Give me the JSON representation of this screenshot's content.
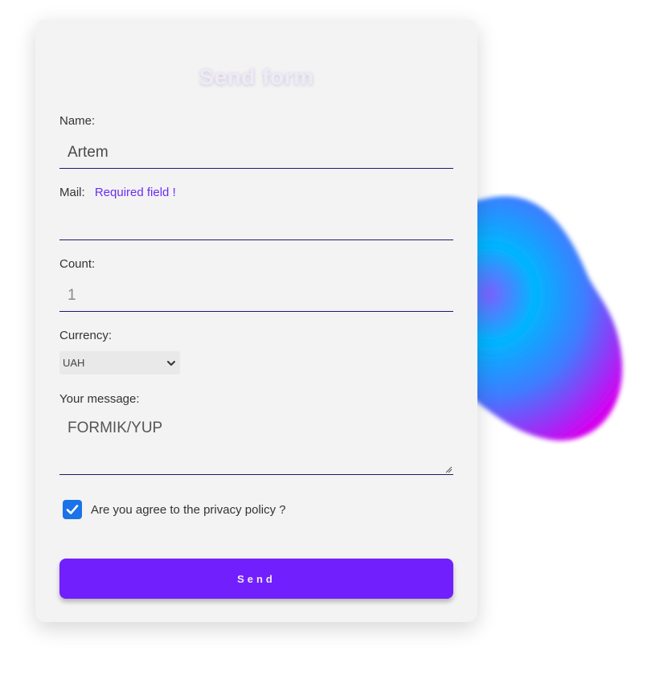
{
  "form": {
    "title": "Send form",
    "name": {
      "label": "Name:",
      "value": "Artem"
    },
    "mail": {
      "label": "Mail:",
      "error": "Required field !",
      "value": ""
    },
    "count": {
      "label": "Count:",
      "value": "1"
    },
    "currency": {
      "label": "Currency:",
      "selected": "UAH"
    },
    "message": {
      "label": "Your message:",
      "value": "FORMIK/YUP"
    },
    "privacy": {
      "label": "Are you agree to the privacy policy ?",
      "checked": true
    },
    "submit_label": "Send"
  },
  "colors": {
    "accent": "#7120fd",
    "error": "#6b2df5",
    "underline": "#1c1a6b",
    "checkbox": "#1a73e8"
  },
  "icons": {
    "select_arrow": "chevron-down-icon",
    "checkbox_mark": "check-icon"
  }
}
